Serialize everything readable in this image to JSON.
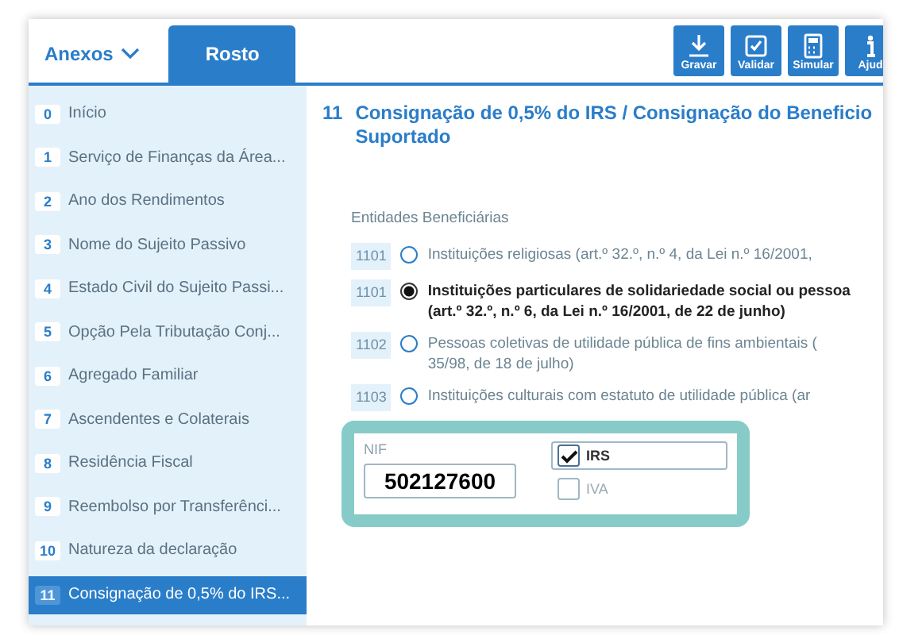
{
  "header": {
    "menu": {
      "label": "Anexos"
    },
    "tabs": [
      {
        "label": "Rosto",
        "selected": true
      }
    ]
  },
  "toolbar": [
    {
      "label": "Gravar",
      "kind": "save"
    },
    {
      "label": "Validar",
      "kind": "validate"
    },
    {
      "label": "Simular",
      "kind": "simulate"
    },
    {
      "label": "Ajud",
      "kind": "help"
    }
  ],
  "sidebar": {
    "items": [
      {
        "number": "0",
        "label": "Início",
        "selected": false
      },
      {
        "number": "1",
        "label": "Serviço de Finanças da Área...",
        "selected": false
      },
      {
        "number": "2",
        "label": "Ano dos Rendimentos",
        "selected": false
      },
      {
        "number": "3",
        "label": "Nome do Sujeito Passivo",
        "selected": false
      },
      {
        "number": "4",
        "label": "Estado Civil do Sujeito Passi...",
        "selected": false
      },
      {
        "number": "5",
        "label": "Opção Pela Tributação Conj...",
        "selected": false
      },
      {
        "number": "6",
        "label": "Agregado Familiar",
        "selected": false
      },
      {
        "number": "7",
        "label": "Ascendentes e Colaterais",
        "selected": false
      },
      {
        "number": "8",
        "label": "Residência Fiscal",
        "selected": false
      },
      {
        "number": "9",
        "label": "Reembolso por Transferênci...",
        "selected": false
      },
      {
        "number": "10",
        "label": "Natureza da declaração",
        "selected": false
      },
      {
        "number": "11",
        "label": "Consignação de 0,5% do IRS...",
        "selected": true
      }
    ]
  },
  "section": {
    "number": "11",
    "title": "Consignação de 0,5% do IRS / Consignação do Beneficio\nSuportado",
    "group_label": "Entidades Beneficiárias",
    "options": [
      {
        "code": "1101",
        "text": "Instituições religiosas (art.º 32.º, n.º 4, da Lei n.º 16/2001,",
        "selected": false
      },
      {
        "code": "1101",
        "text": "Instituições particulares de solidariedade social ou pessoa\n(art.º 32.º, n.º 6, da Lei n.º 16/2001, de 22 de junho)",
        "selected": true
      },
      {
        "code": "1102",
        "text": "Pessoas coletivas de utilidade pública de fins ambientais (\n35/98, de 18 de julho)",
        "selected": false
      },
      {
        "code": "1103",
        "text": "Instituições culturais com estatuto de utilidade pública (ar",
        "selected": false
      }
    ],
    "nif": {
      "label": "NIF",
      "value": "502127600"
    },
    "taxes": [
      {
        "label": "IRS",
        "checked": true
      },
      {
        "label": "IVA",
        "checked": false
      }
    ]
  }
}
